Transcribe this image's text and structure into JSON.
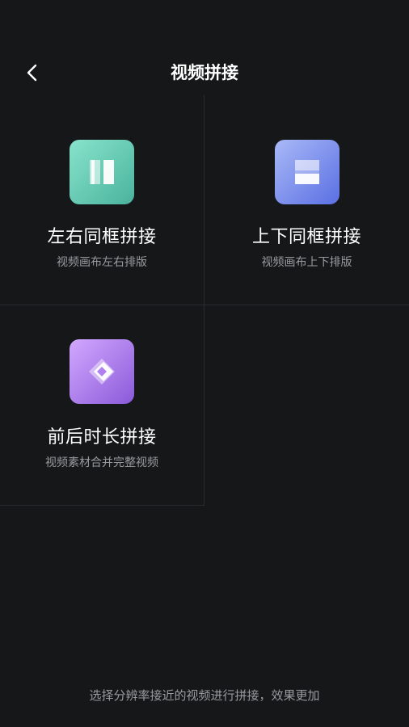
{
  "header": {
    "title": "视频拼接",
    "back_icon": "chevron-left-icon"
  },
  "options": [
    {
      "title": "左右同框拼接",
      "subtitle": "视频画布左右排版",
      "icon": "split-vertical-icon",
      "color_from": "#88e3cb",
      "color_to": "#4ab39d"
    },
    {
      "title": "上下同框拼接",
      "subtitle": "视频画布上下排版",
      "icon": "split-horizontal-icon",
      "color_from": "#a9b9f7",
      "color_to": "#5a6fe3"
    },
    {
      "title": "前后时长拼接",
      "subtitle": "视频素材合并完整视频",
      "icon": "sequence-diamond-icon",
      "color_from": "#d2a8ff",
      "color_to": "#8a5ad9"
    }
  ],
  "footer": {
    "tip": "选择分辨率接近的视频进行拼接，效果更加"
  }
}
